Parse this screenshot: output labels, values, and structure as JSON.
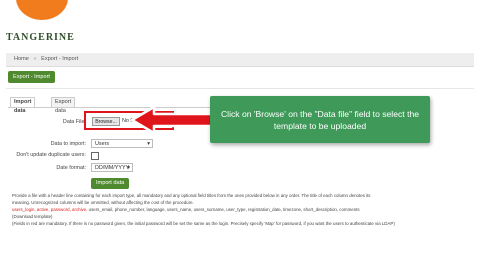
{
  "header": {
    "logo_text": "TANGERINE"
  },
  "breadcrumb": {
    "home": "Home",
    "sep": "»",
    "current": "Export - Import"
  },
  "section_button": {
    "label": "Export - Import"
  },
  "tabs": [
    {
      "label": "Import data",
      "active": true
    },
    {
      "label": "Export data",
      "active": false
    }
  ],
  "form": {
    "data_file_label": "Data File:",
    "browse_label": "Browse...",
    "file_value": "No file selected.",
    "data_to_import_label": "Data to import:",
    "data_to_import_value": "Users",
    "dont_update_label": "Don't update duplicate users:",
    "date_format_label": "Date format:",
    "date_format_value": "DD/MM/YYYY",
    "import_button": "Import data"
  },
  "callout": {
    "text": "Click on 'Browse' on the \"Data file\" field to select the template to be uploaded"
  },
  "info": {
    "line1": "Provide a file with a header line containing for each import type, all mandatory and any optional field titles from the ones provided below in any order. The title of each column denotes its",
    "line2": "meaning. Unrecognized columns will be ommitted, without affecting the cost of the procedure.",
    "required_fields": "users_login, active, password, archive,",
    "optional_fields": " users_email, phone_number, language, users_name, users_surname, user_type, registration_date, timezone, short_description, comments",
    "template_link": "(Download template)",
    "line4": "(Fields in red are mandatory. If there is no password given, the initial password will be set the same as the login. Precisely specify 'Map' for password, if you want the users to authenticate via LDAP)"
  },
  "colors": {
    "accent_green": "#4f8b2e",
    "callout_green": "#3f9a5a",
    "highlight_red": "#e0151c",
    "logo_orange": "#f07c1e"
  }
}
